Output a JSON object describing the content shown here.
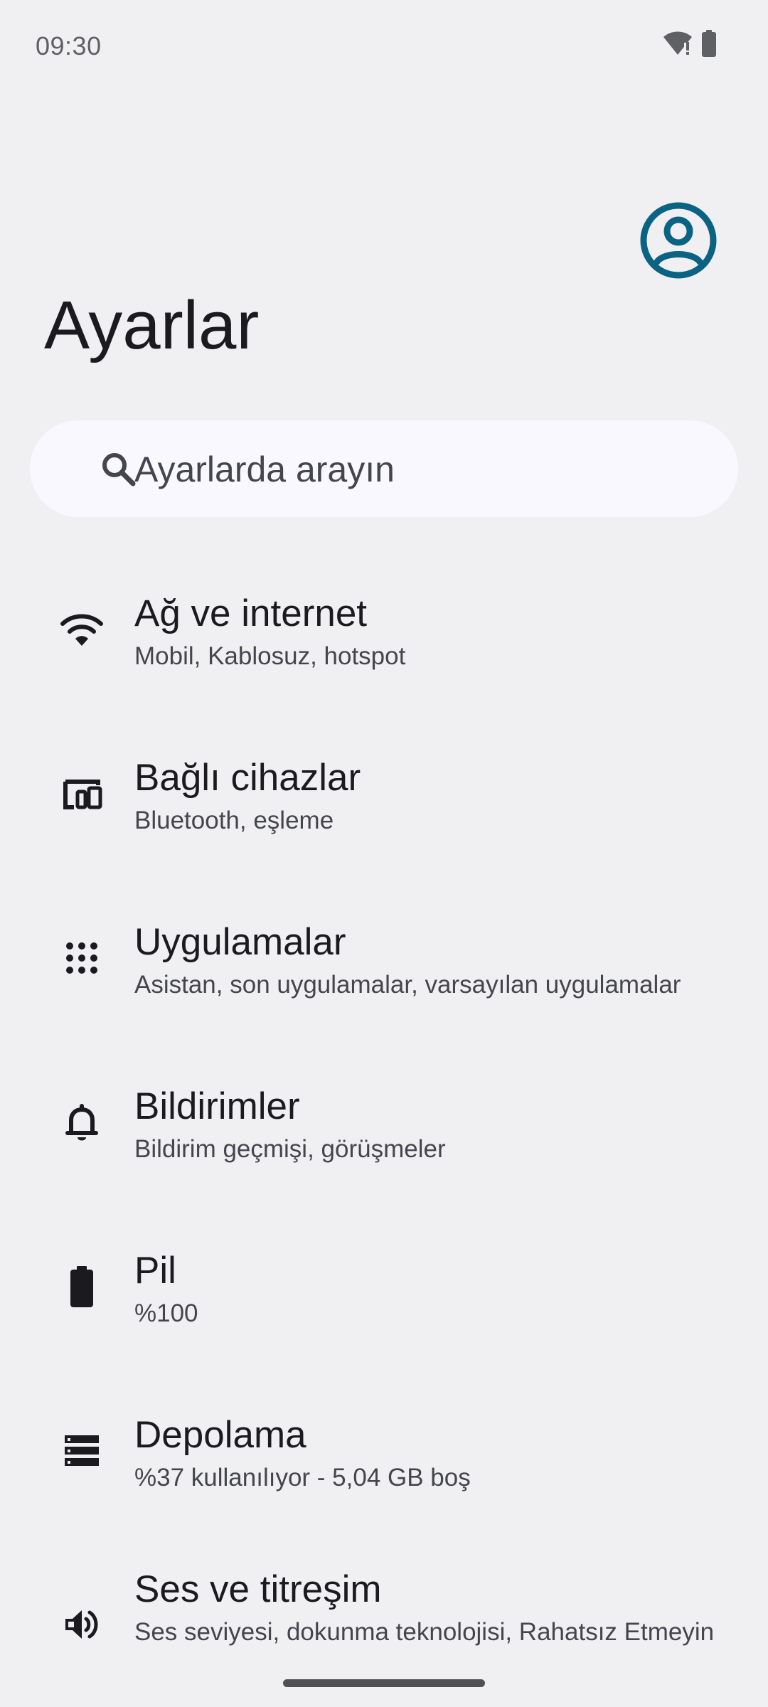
{
  "status_bar": {
    "time": "09:30",
    "icons": [
      "wifi-warning-icon",
      "battery-icon"
    ]
  },
  "colors": {
    "background": "#f0f0f3",
    "search_background": "#f8f8fe",
    "avatar_accent": "#0b6384",
    "text_primary": "#1b1b1f",
    "text_secondary": "#45464c"
  },
  "header": {
    "title": "Ayarlar",
    "avatar_icon": "account-circle-icon"
  },
  "search": {
    "placeholder": "Ayarlarda arayın",
    "icon": "search-icon"
  },
  "settings": [
    {
      "icon": "wifi-icon",
      "title": "Ağ ve internet",
      "subtitle": "Mobil, Kablosuz, hotspot"
    },
    {
      "icon": "connected-devices-icon",
      "title": "Bağlı cihazlar",
      "subtitle": "Bluetooth, eşleme"
    },
    {
      "icon": "apps-grid-icon",
      "title": "Uygulamalar",
      "subtitle": "Asistan, son uygulamalar, varsayılan uygulamalar"
    },
    {
      "icon": "bell-icon",
      "title": "Bildirimler",
      "subtitle": "Bildirim geçmişi, görüşmeler"
    },
    {
      "icon": "battery-icon",
      "title": "Pil",
      "subtitle": "%100"
    },
    {
      "icon": "storage-icon",
      "title": "Depolama",
      "subtitle": "%37 kullanılıyor - 5,04 GB boş"
    },
    {
      "icon": "volume-icon",
      "title": "Ses ve titreşim",
      "subtitle": "Ses seviyesi, dokunma teknolojisi, Rahatsız Etmeyin"
    }
  ]
}
